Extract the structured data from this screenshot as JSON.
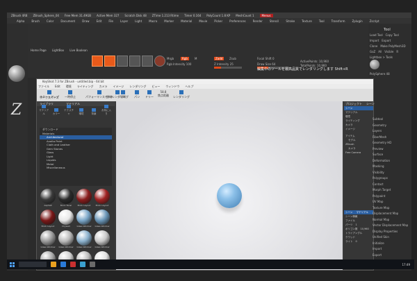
{
  "zbrush": {
    "title_items": [
      "ZBrush 4R8",
      "ZBrush_Sphere_04",
      "Free Mem 31.49GB",
      "Active Mem 327",
      "Scratch Disk 48",
      "ZTime 1.213 Rtime",
      "Timer 0.164",
      "PolyCount 1.8 KP",
      "MeshCount 1"
    ],
    "title_badge": "Menus",
    "menu_items": [
      "Alpha",
      "Brush",
      "Color",
      "Document",
      "Draw",
      "Edit",
      "File",
      "Layer",
      "Light",
      "Macro",
      "Marker",
      "Material",
      "Movie",
      "Picker",
      "Preferences",
      "Render",
      "Stencil",
      "Stroke",
      "Texture",
      "Tool",
      "Transform",
      "Zplugin",
      "Zscript"
    ],
    "nav": [
      "Home Page",
      "LightBox",
      "Live Boolean"
    ],
    "tools": [
      "Edit",
      "Draw",
      "Move",
      "Scale",
      "Rotate"
    ],
    "labels": {
      "mrgb": "Mrgb",
      "rgb": "Rgb",
      "m": "M",
      "zadd": "Zadd",
      "zsub": "Zsub",
      "rgb_intensity": "Rgb Intensity 100",
      "z_intensity": "Z Intensity 25",
      "focal_shift": "Focal Shift 0",
      "draw_size": "Draw Size 64",
      "active_points": "ActivePoints: 10,960",
      "total_points": "TotalPoints: 10,960"
    },
    "render_message": "編集中のツールを最高品質でレンダリングします Shift+R",
    "right_header": "Tool",
    "right_rows": [
      "Load Tool",
      "Copy Tool",
      "Import",
      "Export",
      "Clone",
      "Make PolyMesh3D",
      "GoZ",
      "All",
      "Visible",
      "R",
      "Lightbox > Tools"
    ],
    "polysphere_label": "PolySphere 48",
    "far_rows": [
      "Subtool",
      "Geometry",
      "Layers",
      "FiberMesh",
      "Geometry HD",
      "Preview",
      "Surface",
      "Deformation",
      "Masking",
      "Visibility",
      "Polygroups",
      "Contact",
      "Morph Target",
      "Polypaint",
      "UV Map",
      "Texture Map",
      "Displacement Map",
      "Normal Map",
      "Vector Displacement Map",
      "Display Properties",
      "Unified Skin",
      "Initialize",
      "Import",
      "Export"
    ]
  },
  "keyshot": {
    "title": "KeyShot 7.3 for ZBrush - untitled.bip - 64 bit",
    "menu": [
      "ファイル",
      "Edit",
      "環境",
      "ライティング",
      "カメラ",
      "イメージ",
      "レンダリング",
      "ビュー",
      "ウィンドウ",
      "ヘルプ"
    ],
    "toolbar": [
      "スタートアップ",
      "ワークスペース",
      "一時停止",
      "パフォーマンスモード",
      "領域レンダリング",
      "切断",
      "パン",
      "ドリー",
      "焦点距離",
      "レンダリング"
    ],
    "toolbar_extra": "58.8",
    "library_header": "ライブラリ",
    "library_title": "マテリアル",
    "library_tabs": [
      "マテリアル",
      "カラー",
      "テクスチャ",
      "環境",
      "背景",
      "お気に入り"
    ],
    "tree": [
      "ダウンロード",
      "Materials",
      "Architectural",
      "Axalta Paint",
      "Cloth and Leather",
      "Gem Stones",
      "Glass",
      "Light",
      "Liquids",
      "Metal",
      "Miscellaneous"
    ],
    "materials": [
      {
        "name": "Asphalt",
        "color": "#3a3a3a"
      },
      {
        "name": "Brick Tonal",
        "color": "#2a2a2a"
      },
      {
        "name": "Brick Layout",
        "color": "#8a1c1c"
      },
      {
        "name": "Brick Layout",
        "color": "#a02222"
      },
      {
        "name": "Brick Layout",
        "color": "#7a1818"
      },
      {
        "name": "Drywall",
        "color": "#e8e8e8"
      },
      {
        "name": "Glass Window",
        "color": "#7aa6c8"
      },
      {
        "name": "Glass Window",
        "color": "#6a96b8"
      },
      {
        "name": "Glass Window",
        "color": "#9a9a9a"
      },
      {
        "name": "Glass Window",
        "color": "#b8b8b8"
      },
      {
        "name": "Glass Window",
        "color": "#8ab0cc"
      },
      {
        "name": "Glass Window",
        "color": "#c8c8c8"
      },
      {
        "name": "Interior Dry",
        "color": "#aaaaaa"
      },
      {
        "name": "Terrazzo Flo",
        "color": "#d0d0d0"
      },
      {
        "name": "Terrazzo Flo",
        "color": "#bcbcbc"
      },
      {
        "name": "Tile Herring",
        "color": "#e0e0e0"
      }
    ],
    "project_header": "プロジェクト",
    "scene_header": "シーン",
    "project_items": [
      "シーン",
      "マテリアル",
      "環境",
      "ライティング",
      "カメラ",
      "イメージ"
    ],
    "scene_tree": [
      "アイテム",
      "モデル",
      "ZBrush",
      "カメラ",
      "Free Camera"
    ],
    "scene_info_header": "シーン情報",
    "scene_info": [
      "ファイル",
      "パーツ",
      "ポリゴン数",
      "トライアングル",
      "クワッド",
      "ライト"
    ],
    "scene_info_vals": [
      "",
      "1",
      "10,960",
      "",
      "",
      "0"
    ],
    "bottom_tabs": [
      "シーン",
      "マテリアル"
    ]
  },
  "taskbar": {
    "clock": "17:49"
  }
}
